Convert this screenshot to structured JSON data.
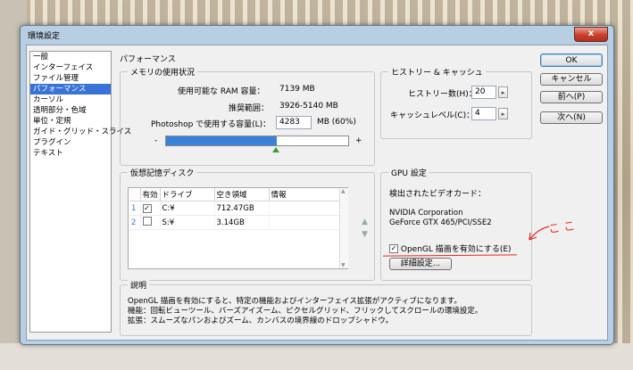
{
  "window": {
    "title": "環境設定",
    "close_glyph": "x"
  },
  "categories": [
    {
      "label": "一般",
      "selected": false
    },
    {
      "label": "インターフェイス",
      "selected": false
    },
    {
      "label": "ファイル管理",
      "selected": false
    },
    {
      "label": "パフォーマンス",
      "selected": true
    },
    {
      "label": "カーソル",
      "selected": false
    },
    {
      "label": "透明部分・色域",
      "selected": false
    },
    {
      "label": "単位・定規",
      "selected": false
    },
    {
      "label": "ガイド・グリッド・スライス",
      "selected": false
    },
    {
      "label": "プラグイン",
      "selected": false
    },
    {
      "label": "テキスト",
      "selected": false
    }
  ],
  "section_title": "パフォーマンス",
  "memory": {
    "group_label": "メモリの使用状況",
    "available_label": "使用可能な RAM 容量：",
    "available_value": "7139 MB",
    "range_label": "推奨範囲：",
    "range_value": "3926-5140 MB",
    "use_label": "Photoshop で使用する容量(L)：",
    "use_value": "4283",
    "use_unit": "MB (60%)",
    "slider_minus": "-",
    "slider_plus": "+",
    "slider_fraction": 0.6
  },
  "history": {
    "group_label": "ヒストリー & キャッシュ",
    "states_label": "ヒストリー数(H)：",
    "states_value": "20",
    "cache_label": "キャッシュレベル(C)：",
    "cache_value": "4"
  },
  "scratch": {
    "group_label": "仮想記憶ディスク",
    "columns": [
      "",
      "有効",
      "ドライブ",
      "空き領域",
      "情報"
    ],
    "rows": [
      {
        "num": "1",
        "active": true,
        "drive": "C:¥",
        "free": "712.47GB",
        "info": ""
      },
      {
        "num": "2",
        "active": false,
        "drive": "S:¥",
        "free": "3.14GB",
        "info": ""
      }
    ]
  },
  "gpu": {
    "group_label": "GPU 設定",
    "detected_label": "検出されたビデオカード：",
    "card_line1": "NVIDIA Corporation",
    "card_line2": "GeForce GTX 465/PCI/SSE2",
    "opengl_label": "OpenGL 描画を有効にする(E)",
    "opengl_checked": true,
    "advanced_label": "詳細設定..."
  },
  "annotation": {
    "text": "ここ",
    "color": "#e8271f"
  },
  "description": {
    "group_label": "説明",
    "lines": [
      "OpenGL 描画を有効にすると、特定の機能およびインターフェイス拡張がアクティブになります。",
      "機能：回転ビューツール、バーズアイズーム、ピクセルグリッド、フリックしてスクロールの環境設定。",
      "拡張：スムーズなパンおよびズーム、カンバスの境界線のドロップシャドウ。"
    ]
  },
  "buttons": {
    "ok": "OK",
    "cancel": "キャンセル",
    "prev": "前へ(P)",
    "next": "次へ(N)"
  }
}
